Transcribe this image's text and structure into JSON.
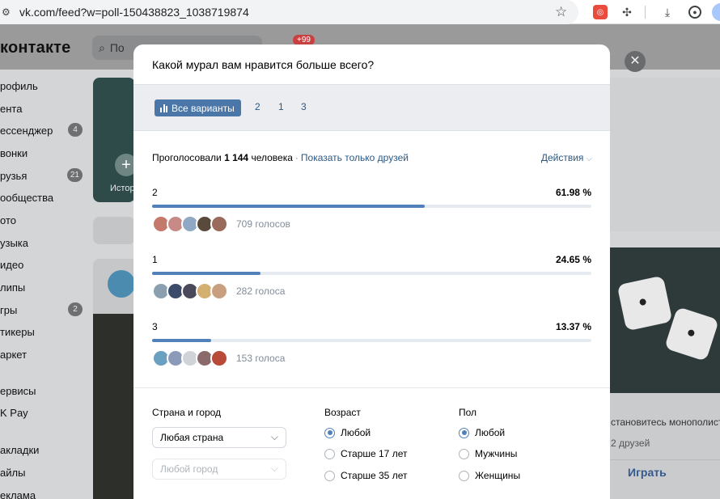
{
  "browser": {
    "url": "vk.com/feed?w=poll-150438823_1038719874"
  },
  "vk": {
    "logo": "контакте",
    "search_placeholder": "По",
    "notif_badge": "+99",
    "sidebar": [
      {
        "label": "рофиль"
      },
      {
        "label": "ента"
      },
      {
        "label": "ессенджер",
        "count": "4"
      },
      {
        "label": "вонки"
      },
      {
        "label": "рузья",
        "count": "21"
      },
      {
        "label": "ообщества"
      },
      {
        "label": "ото"
      },
      {
        "label": "узыка"
      },
      {
        "label": "идео"
      },
      {
        "label": "липы"
      },
      {
        "label": "гры",
        "count": "2"
      },
      {
        "label": "тикеры"
      },
      {
        "label": "аркет"
      },
      {
        "label": "ервисы"
      },
      {
        "label": "K Pay"
      },
      {
        "label": "акладки"
      },
      {
        "label": "айлы"
      },
      {
        "label": "еклама"
      }
    ],
    "story_label": "Истор",
    "right_card": {
      "text1": "становитесь монополисто",
      "text2": "2 друзей",
      "play_label": "Играть"
    }
  },
  "poll": {
    "title": "Какой мурал вам нравится больше всего?",
    "tabs": {
      "all_label": "Все варианты",
      "others": [
        "2",
        "1",
        "3"
      ]
    },
    "summary": {
      "voted_prefix": "Проголосовали",
      "voted_count": "1 144",
      "voted_suffix": "человека",
      "friends_link": "Показать только друзей",
      "actions_label": "Действия"
    },
    "options": [
      {
        "label": "2",
        "percent": "61.98 %",
        "share": 61.98,
        "votes": "709 голосов",
        "avatar_colors": [
          "#c47a6a",
          "#c88a86",
          "#8fa8c4",
          "#5a4a3c",
          "#9a6a5a"
        ]
      },
      {
        "label": "1",
        "percent": "24.65 %",
        "share": 24.65,
        "votes": "282 голоса",
        "avatar_colors": [
          "#8aa0b0",
          "#3c4a6a",
          "#4a4a5a",
          "#d4b070",
          "#c8a080"
        ]
      },
      {
        "label": "3",
        "percent": "13.37 %",
        "share": 13.37,
        "votes": "153 голоса",
        "avatar_colors": [
          "#6aa0c0",
          "#8a9ab8",
          "#d0d4d8",
          "#8a6a6a",
          "#b84a3a"
        ]
      }
    ],
    "filters": {
      "location": {
        "heading": "Страна и город",
        "country_value": "Любая страна",
        "city_value": "Любой город"
      },
      "age": {
        "heading": "Возраст",
        "options": [
          "Любой",
          "Старше 17 лет",
          "Старше 35 лет"
        ],
        "selected": 0
      },
      "gender": {
        "heading": "Пол",
        "options": [
          "Любой",
          "Мужчины",
          "Женщины"
        ],
        "selected": 0
      }
    }
  }
}
